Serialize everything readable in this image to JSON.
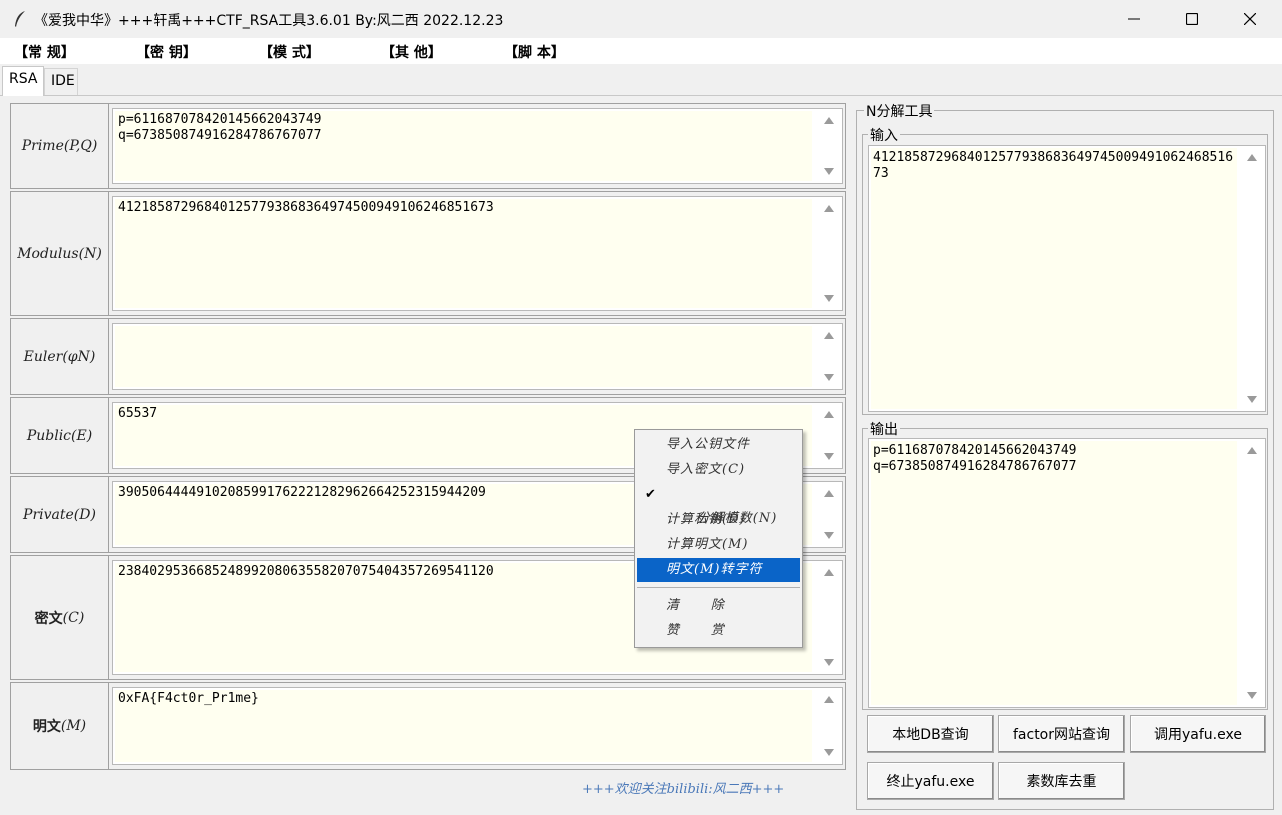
{
  "window": {
    "title": "《爱我中华》+++轩禹+++CTF_RSA工具3.6.01   By:风二西 2022.12.23"
  },
  "menu": [
    "【常    规】",
    "【密    钥】",
    "【模    式】",
    "【其    他】",
    "【脚    本】"
  ],
  "tabs": [
    "RSA",
    "IDE"
  ],
  "rsa": {
    "prime_label": "Prime(P,Q)",
    "prime_value": "p=611687078420145662043749\nq=673850874916284786767077",
    "modulus_label": "Modulus(N)",
    "modulus_value": "412185872968401257793868364974500949106246851673",
    "euler_label": "Euler(φN)",
    "euler_value": "",
    "public_label": "Public(E)",
    "public_value": "65537",
    "private_label": "Private(D)",
    "private_value": "39050644449102085991762221282962664252315944209",
    "cipher_label_cn": "密文",
    "cipher_label_en": "(C)",
    "cipher_value": "238402953668524899208063558207075404357269541120",
    "plain_label_cn": "明文",
    "plain_label_en": "(M)",
    "plain_value": "0xFA{F4ct0r_Pr1me}"
  },
  "footer_note": "+++欢迎关注bilibili:风二西+++",
  "nfactor": {
    "group_title": "N分解工具",
    "input_label": "输入",
    "input_value": "412185872968401257793868364974500949106246851673",
    "output_label": "输出",
    "output_value": "p=611687078420145662043749\nq=673850874916284786767077",
    "buttons": {
      "local_db": "本地DB查询",
      "factor_site": "factor网站查询",
      "call_yafu": "调用yafu.exe",
      "stop_yafu": "终止yafu.exe",
      "prime_dedup": "素数库去重"
    }
  },
  "context_menu": {
    "import_pubkey": "导入公钥文件",
    "import_cipher": "导入密文(C)",
    "factor_modulus": "分解模数(N)",
    "calc_private": "计算私钥(D)",
    "calc_plain": "计算明文(M)",
    "plain_to_str": "明文(M)转字符",
    "clear": "清      除",
    "reward": "赞      赏",
    "checkmark": "✔"
  },
  "colors": {
    "field_bg": "#fffff0",
    "menu_selection": "#0a64c8",
    "footer_text": "#4a78b8"
  }
}
